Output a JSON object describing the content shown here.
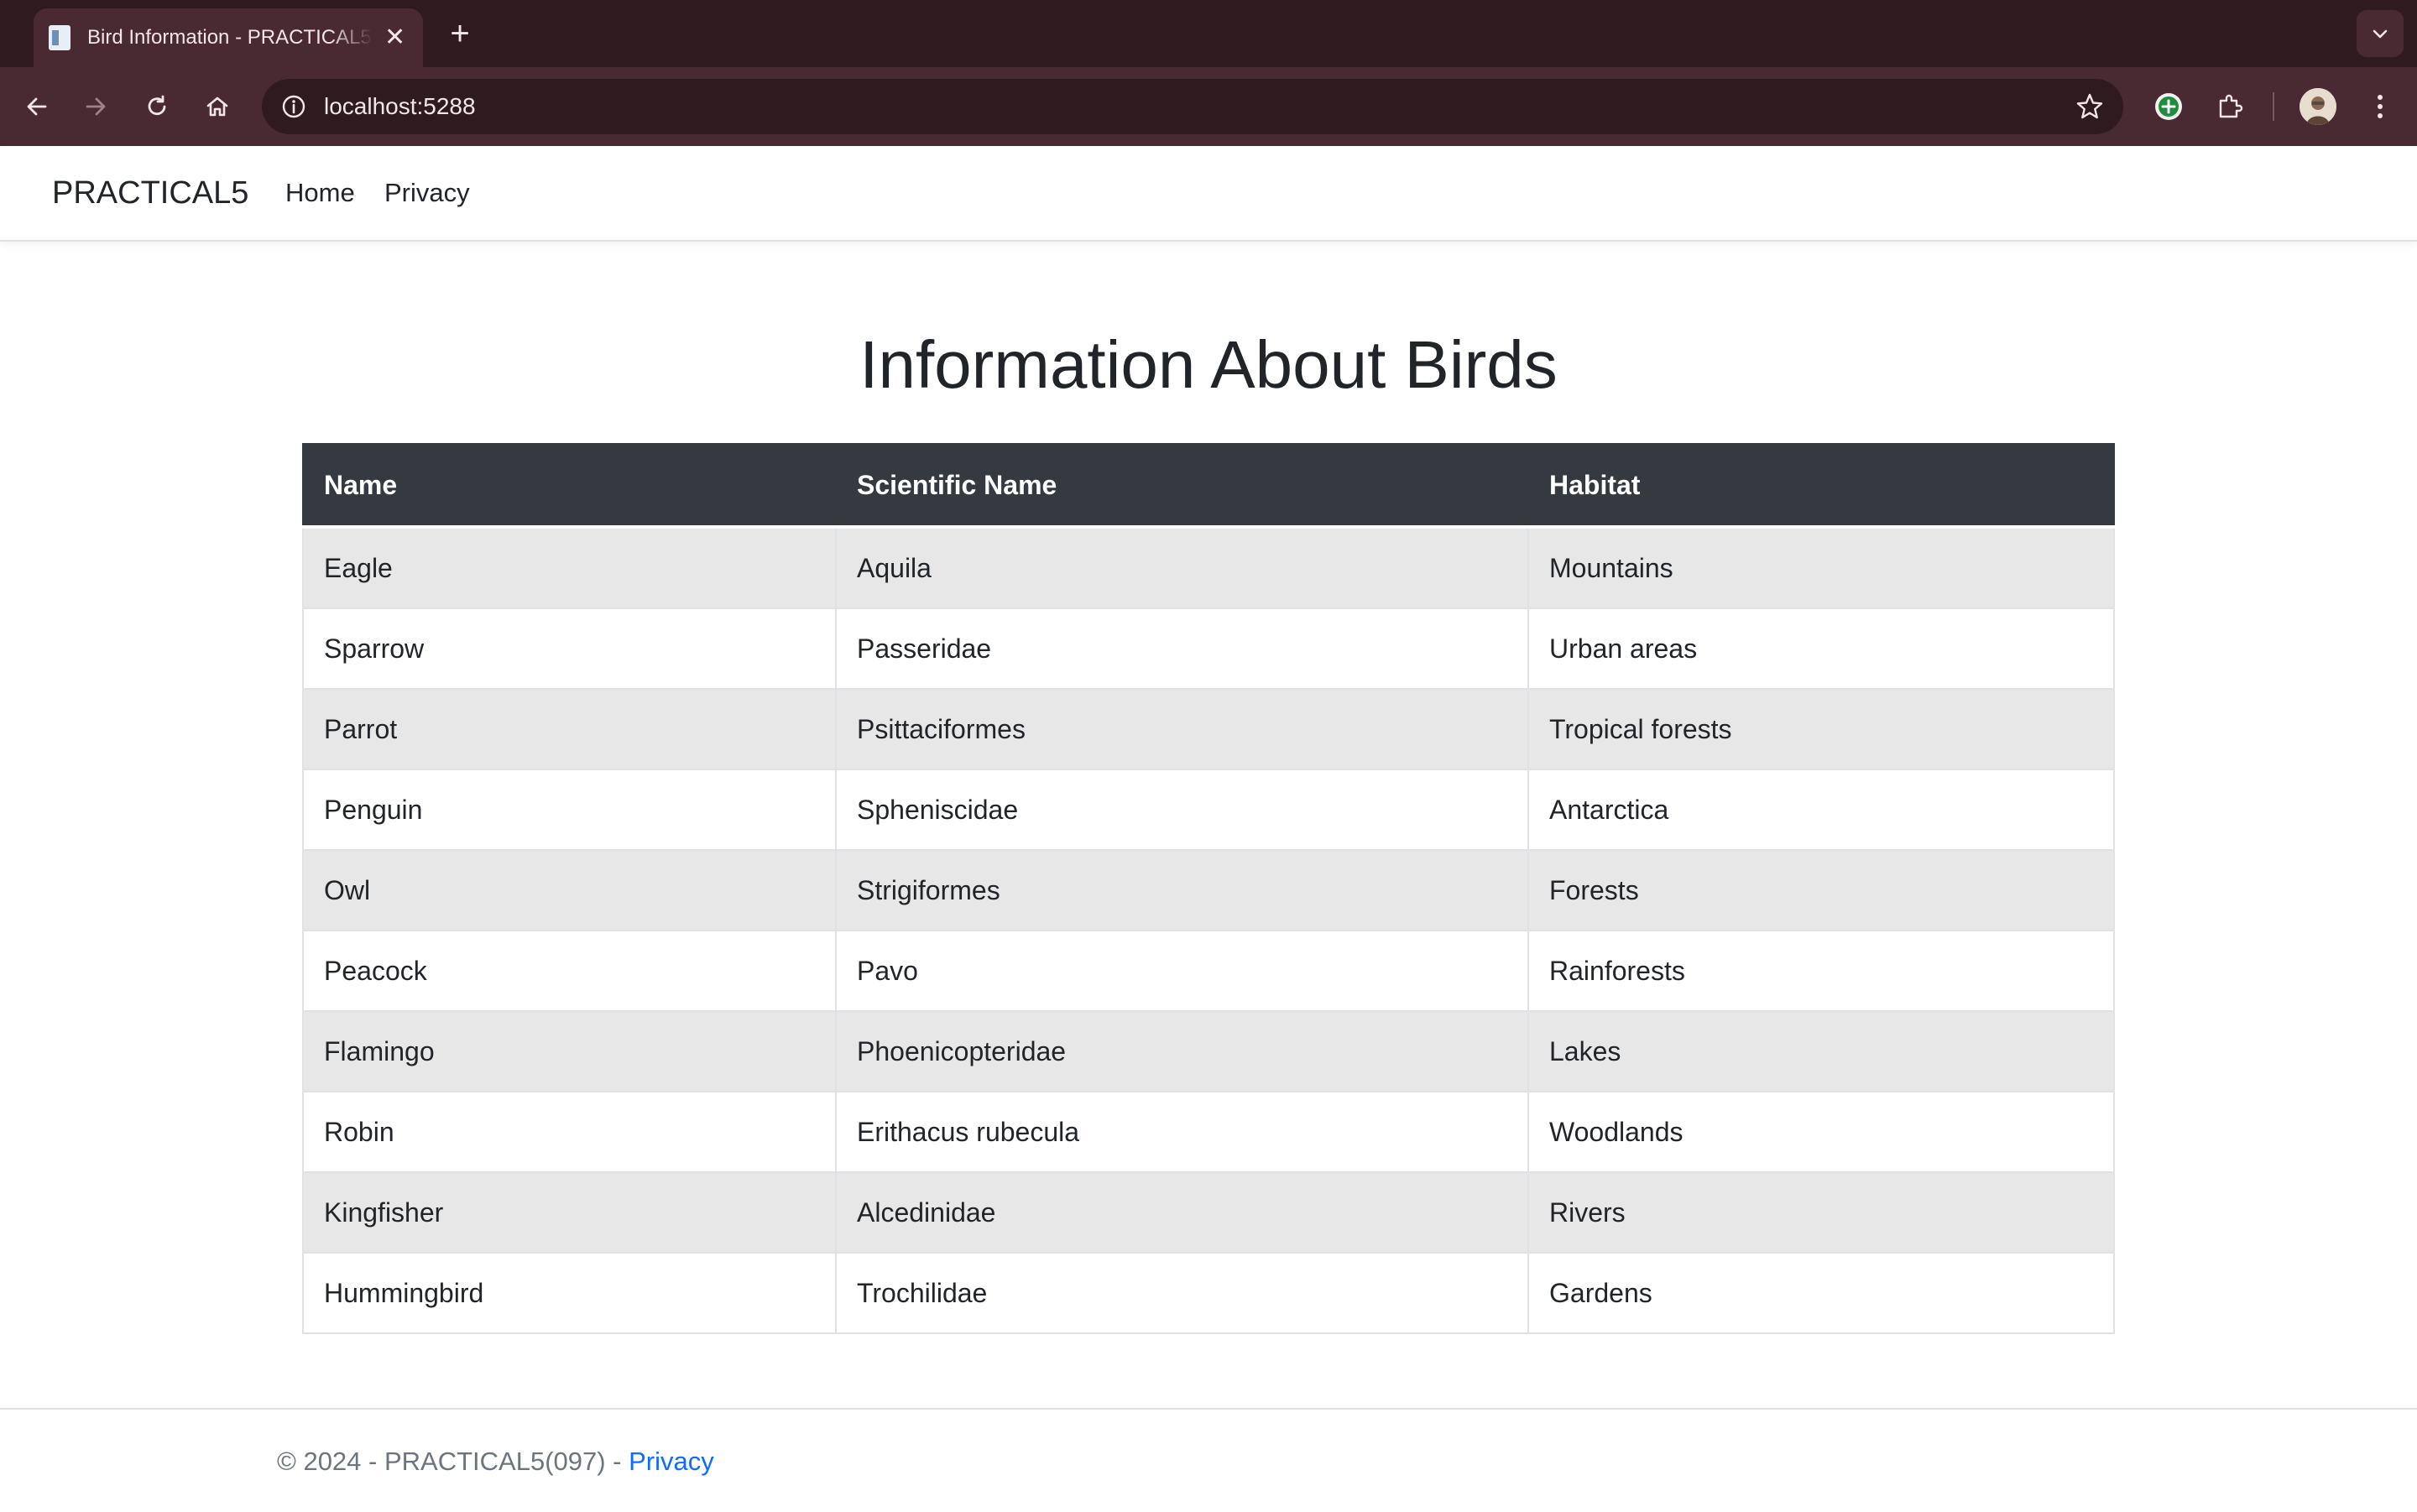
{
  "browser": {
    "tab_title": "Bird Information - PRACTICAL5",
    "close_glyph": "✕",
    "new_tab_glyph": "+",
    "url": "localhost:5288"
  },
  "site": {
    "brand": "PRACTICAL5",
    "nav": {
      "home": "Home",
      "privacy": "Privacy"
    }
  },
  "main": {
    "title": "Information About Birds",
    "table": {
      "headers": [
        "Name",
        "Scientific Name",
        "Habitat"
      ],
      "rows": [
        [
          "Eagle",
          "Aquila",
          "Mountains"
        ],
        [
          "Sparrow",
          "Passeridae",
          "Urban areas"
        ],
        [
          "Parrot",
          "Psittaciformes",
          "Tropical forests"
        ],
        [
          "Penguin",
          "Spheniscidae",
          "Antarctica"
        ],
        [
          "Owl",
          "Strigiformes",
          "Forests"
        ],
        [
          "Peacock",
          "Pavo",
          "Rainforests"
        ],
        [
          "Flamingo",
          "Phoenicopteridae",
          "Lakes"
        ],
        [
          "Robin",
          "Erithacus rubecula",
          "Woodlands"
        ],
        [
          "Kingfisher",
          "Alcedinidae",
          "Rivers"
        ],
        [
          "Hummingbird",
          "Trochilidae",
          "Gardens"
        ]
      ]
    }
  },
  "footer": {
    "text": "© 2024 - PRACTICAL5(097) - ",
    "privacy_link": "Privacy"
  },
  "colors": {
    "chrome_dark": "#2f1a20",
    "chrome_toolbar": "#4a2a32",
    "table_header_bg": "#343a40",
    "table_stripe": "#e7e7e7",
    "link": "#0d6efd"
  },
  "icons": {
    "tab_favicon": "document-icon",
    "back": "arrow-left-icon",
    "forward": "arrow-right-icon",
    "reload": "reload-icon",
    "home": "home-icon",
    "site_info": "info-icon",
    "bookmark": "star-icon",
    "extension_add": "plus-circle-icon",
    "extensions": "puzzle-icon",
    "menu": "kebab-menu-icon",
    "tab_list": "chevron-down-icon"
  }
}
